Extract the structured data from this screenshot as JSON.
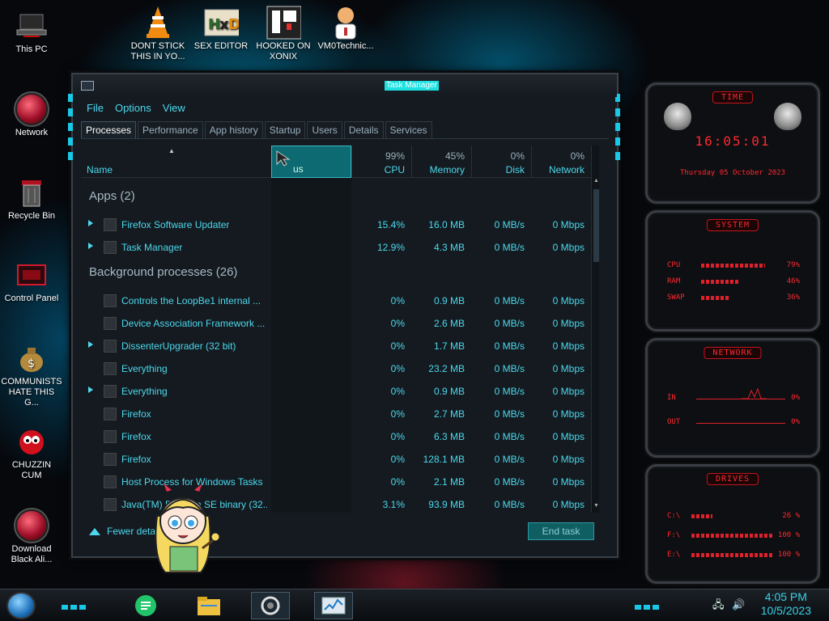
{
  "desktop": {
    "icons": [
      {
        "label": "This PC"
      },
      {
        "label": "Network"
      },
      {
        "label": "Recycle Bin"
      },
      {
        "label": "Control Panel"
      },
      {
        "label": "COMMUNISTS HATE THIS G..."
      },
      {
        "label": "CHUZZIN CUM"
      },
      {
        "label": "Download Black Ali..."
      },
      {
        "label": "DONT STICK THIS IN YO..."
      },
      {
        "label": "SEX EDITOR"
      },
      {
        "label": "HOOKED ON XONIX"
      },
      {
        "label": "VM0Technic..."
      }
    ]
  },
  "window": {
    "title": "Task Manager",
    "menu": [
      "File",
      "Options",
      "View"
    ],
    "tabs": [
      "Processes",
      "Performance",
      "App history",
      "Startup",
      "Users",
      "Details",
      "Services"
    ],
    "active_tab": "Processes",
    "columns": {
      "name": "Name",
      "status": "us",
      "cpu": {
        "label": "CPU",
        "pct": "99%"
      },
      "memory": {
        "label": "Memory",
        "pct": "45%"
      },
      "disk": {
        "label": "Disk",
        "pct": "0%"
      },
      "network": {
        "label": "Network",
        "pct": "0%"
      }
    },
    "groups": {
      "apps": "Apps (2)",
      "background": "Background processes (26)"
    },
    "apps": [
      {
        "name": "Firefox Software Updater",
        "cpu": "15.4%",
        "mem": "16.0 MB",
        "disk": "0 MB/s",
        "net": "0 Mbps",
        "expand": true
      },
      {
        "name": "Task Manager",
        "cpu": "12.9%",
        "mem": "4.3 MB",
        "disk": "0 MB/s",
        "net": "0 Mbps",
        "expand": true
      }
    ],
    "background": [
      {
        "name": "Controls the LoopBe1 internal ...",
        "cpu": "0%",
        "mem": "0.9 MB",
        "disk": "0 MB/s",
        "net": "0 Mbps",
        "expand": false
      },
      {
        "name": "Device Association Framework ...",
        "cpu": "0%",
        "mem": "2.6 MB",
        "disk": "0 MB/s",
        "net": "0 Mbps",
        "expand": false
      },
      {
        "name": "DissenterUpgrader (32 bit)",
        "cpu": "0%",
        "mem": "1.7 MB",
        "disk": "0 MB/s",
        "net": "0 Mbps",
        "expand": true
      },
      {
        "name": "Everything",
        "cpu": "0%",
        "mem": "23.2 MB",
        "disk": "0 MB/s",
        "net": "0 Mbps",
        "expand": false
      },
      {
        "name": "Everything",
        "cpu": "0%",
        "mem": "0.9 MB",
        "disk": "0 MB/s",
        "net": "0 Mbps",
        "expand": true
      },
      {
        "name": "Firefox",
        "cpu": "0%",
        "mem": "2.7 MB",
        "disk": "0 MB/s",
        "net": "0 Mbps",
        "expand": false
      },
      {
        "name": "Firefox",
        "cpu": "0%",
        "mem": "6.3 MB",
        "disk": "0 MB/s",
        "net": "0 Mbps",
        "expand": false
      },
      {
        "name": "Firefox",
        "cpu": "0%",
        "mem": "128.1 MB",
        "disk": "0 MB/s",
        "net": "0 Mbps",
        "expand": false
      },
      {
        "name": "Host Process for Windows Tasks",
        "cpu": "0%",
        "mem": "2.1 MB",
        "disk": "0 MB/s",
        "net": "0 Mbps",
        "expand": false
      },
      {
        "name": "Java(TM) Platform SE binary (32...",
        "cpu": "3.1%",
        "mem": "93.9 MB",
        "disk": "0 MB/s",
        "net": "0 Mbps",
        "expand": false
      }
    ],
    "fewer_details": "Fewer details",
    "end_task": "End task"
  },
  "gadgets": {
    "time": {
      "tag": "TIME",
      "clock": "16:05:01",
      "date": "Thursday 05 October 2023"
    },
    "system": {
      "tag": "SYSTEM",
      "cpu_label": "CPU",
      "ram_label": "RAM",
      "swap_label": "SWAP",
      "cpu_val": "79%",
      "ram_val": "46%",
      "swap_val": "36%",
      "cpu": 0.79,
      "ram": 0.46,
      "swap": 0.36
    },
    "network": {
      "tag": "NETWORK",
      "in_label": "IN",
      "out_label": "OUT",
      "in_val": "0%",
      "out_val": "0%"
    },
    "drives": {
      "tag": "DRIVES",
      "c_label": "C:\\",
      "f_label": "F:\\",
      "e_label": "E:\\",
      "c_val": "26 %",
      "f_val": "100 %",
      "e_val": "100 %",
      "c": 0.26,
      "f": 1.0,
      "e": 1.0
    }
  },
  "taskbar": {
    "time": "4:05 PM",
    "date": "10/5/2023"
  },
  "colors": {
    "accent": "#4dd8ee",
    "gadget_red": "#ff2830"
  }
}
